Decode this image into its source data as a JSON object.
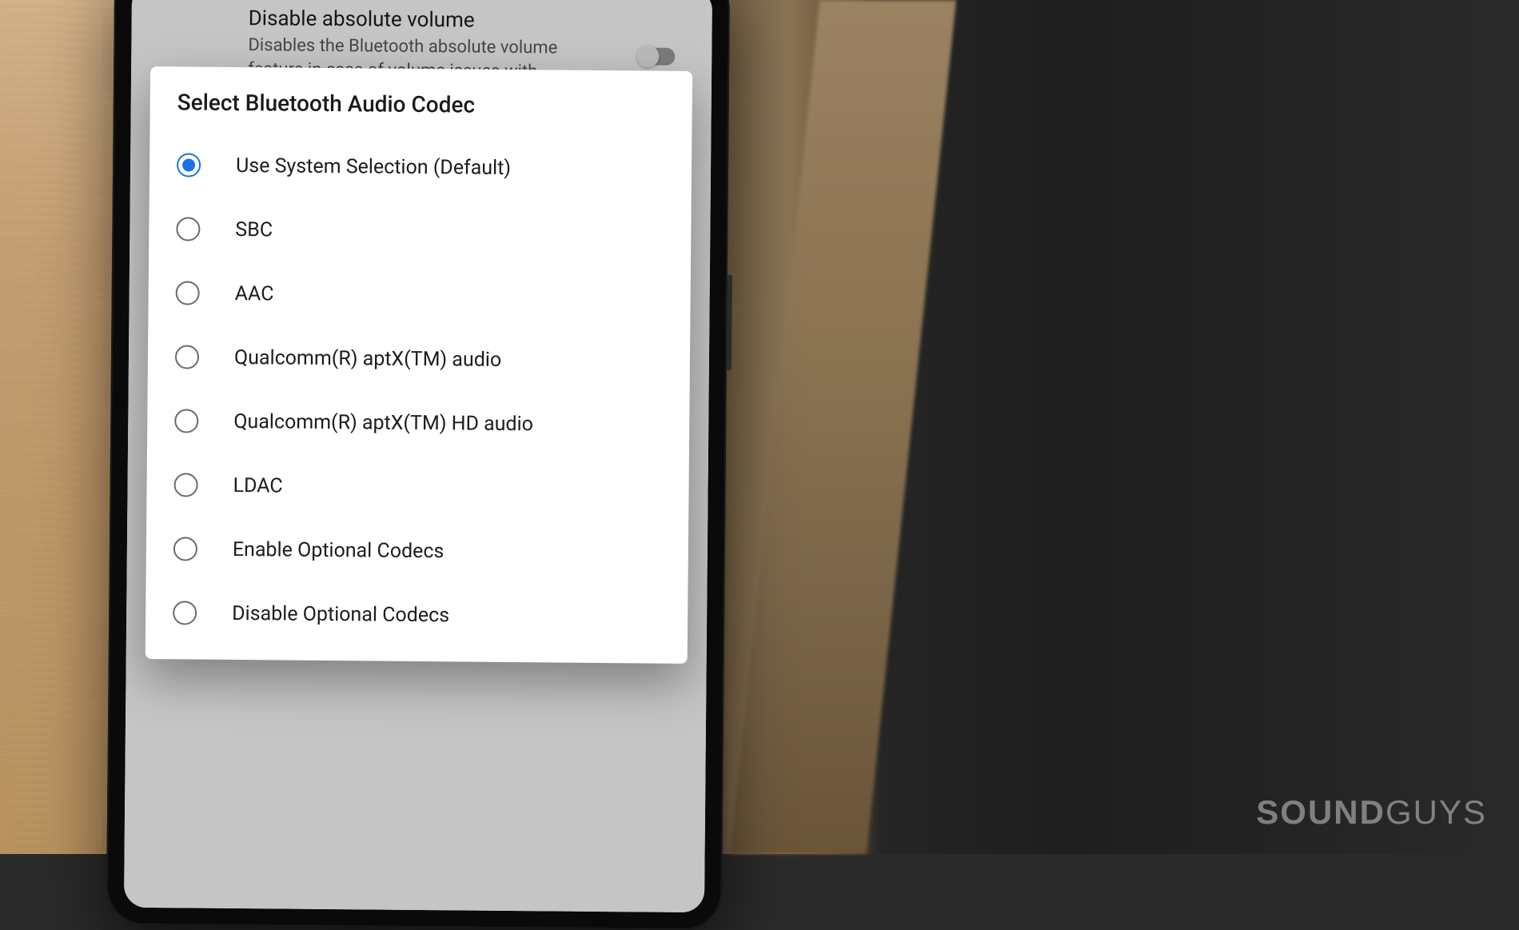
{
  "background_setting": {
    "title": "Disable absolute volume",
    "description": "Disables the Bluetooth absolute volume feature in case of volume issues with"
  },
  "dialog": {
    "title": "Select Bluetooth Audio Codec",
    "options": [
      {
        "label": "Use System Selection (Default)",
        "selected": true
      },
      {
        "label": "SBC",
        "selected": false
      },
      {
        "label": "AAC",
        "selected": false
      },
      {
        "label": "Qualcomm(R) aptX(TM) audio",
        "selected": false
      },
      {
        "label": "Qualcomm(R) aptX(TM) HD audio",
        "selected": false
      },
      {
        "label": "LDAC",
        "selected": false
      },
      {
        "label": "Enable Optional Codecs",
        "selected": false
      },
      {
        "label": "Disable Optional Codecs",
        "selected": false
      }
    ]
  },
  "watermark": {
    "bold": "SOUND",
    "light": "GUYS"
  }
}
